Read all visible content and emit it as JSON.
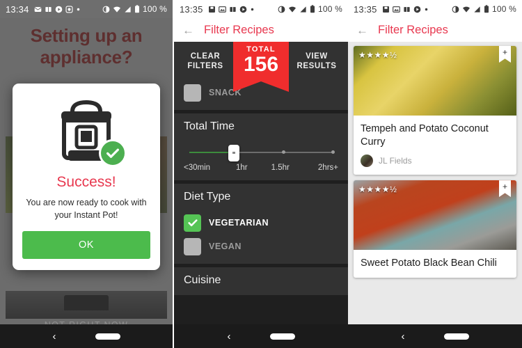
{
  "screens": {
    "setup": {
      "status_bar": {
        "time": "13:34",
        "battery": "100 %",
        "icons": [
          "sms-icon",
          "photo-icon",
          "book-icon",
          "play-icon",
          "dot-icon"
        ],
        "right_icons": [
          "dnd-icon",
          "wifi-icon",
          "signal-icon",
          "battery-icon"
        ]
      },
      "hero_title": "Setting up an appliance?",
      "secondary_action": "NOT RIGHT NOW",
      "dialog": {
        "icon": "instant-pot-icon",
        "badge": "success-check-icon",
        "title": "Success!",
        "message": "You are now ready to cook with your Instant Pot!",
        "ok_label": "OK",
        "ok_color": "#4cbb4c"
      },
      "nav": {
        "back": "‹",
        "home": "home-pill"
      }
    },
    "filters": {
      "status_bar": {
        "time": "13:35",
        "battery": "100 %"
      },
      "appbar": {
        "back_icon": "back-arrow-icon",
        "title": "Filter Recipes",
        "title_color": "#e8384f"
      },
      "actions": {
        "clear": "CLEAR FILTERS",
        "view": "VIEW RESULTS"
      },
      "total_badge": {
        "label": "TOTAL",
        "count": "156",
        "color": "#f02d2d"
      },
      "meal_type": {
        "items": [
          {
            "label": "SNACK",
            "checked": false
          }
        ]
      },
      "total_time": {
        "title": "Total Time",
        "ticks": [
          "<30min",
          "1hr",
          "1.5hr",
          "2hrs+"
        ],
        "selected": "1hr",
        "fill_color": "#3c8c3c"
      },
      "diet_type": {
        "title": "Diet Type",
        "items": [
          {
            "label": "VEGETARIAN",
            "checked": true
          },
          {
            "label": "VEGAN",
            "checked": false
          }
        ]
      },
      "cuisine": {
        "title": "Cuisine"
      },
      "nav": {
        "back": "‹",
        "home": "home-pill"
      }
    },
    "results": {
      "status_bar": {
        "time": "13:35",
        "battery": "100 %"
      },
      "appbar": {
        "back_icon": "back-arrow-icon",
        "title": "Filter Recipes",
        "title_color": "#e8384f"
      },
      "cards": [
        {
          "rating": "★★★★½",
          "rating_value": "4.5",
          "bookmark_icon": "bookmark-add-icon",
          "title": "Tempeh and Potato Coconut Curry",
          "author": "JL Fields",
          "has_author": true
        },
        {
          "rating": "★★★★½",
          "rating_value": "4.5",
          "bookmark_icon": "bookmark-add-icon",
          "title": "Sweet Potato Black Bean Chili",
          "author": "",
          "has_author": false
        }
      ],
      "nav": {
        "back": "‹",
        "home": "home-pill"
      }
    }
  }
}
